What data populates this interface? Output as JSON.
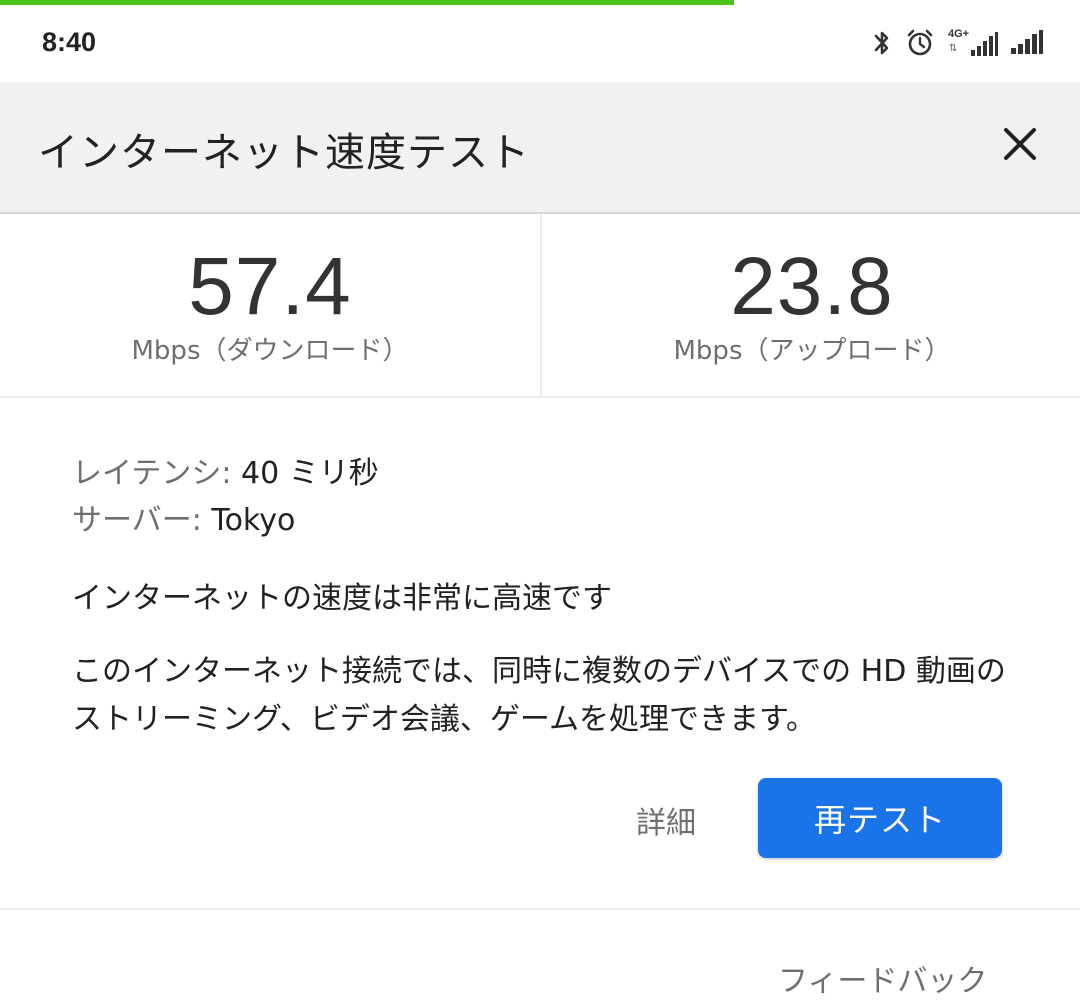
{
  "progress": {
    "fraction": 0.68,
    "color": "#4cc417"
  },
  "status_bar": {
    "time": "8:40",
    "icons": [
      "bluetooth-icon",
      "alarm-icon",
      "signal-icon",
      "signal-icon"
    ],
    "network_type": "4G+",
    "data_arrows": "⇅"
  },
  "app_bar": {
    "title": "インターネット速度テスト",
    "close_icon": "close-icon"
  },
  "speeds": {
    "download": {
      "value": "57.4",
      "label": "Mbps（ダウンロード）"
    },
    "upload": {
      "value": "23.8",
      "label": "Mbps（アップロード）"
    }
  },
  "details": {
    "latency_key": "レイテンシ:",
    "latency_value": " 40 ミリ秒",
    "server_key": "サーバー:",
    "server_value": " Tokyo",
    "headline": "インターネットの速度は非常に高速です",
    "description": "このインターネット接続では、同時に複数のデバイスでの HD 動画のストリーミング、ビデオ会議、ゲームを処理できます。"
  },
  "actions": {
    "details_label": "詳細",
    "retest_label": "再テスト",
    "accent_color": "#1a73e8"
  },
  "footer": {
    "feedback_label": "フィードバック"
  }
}
